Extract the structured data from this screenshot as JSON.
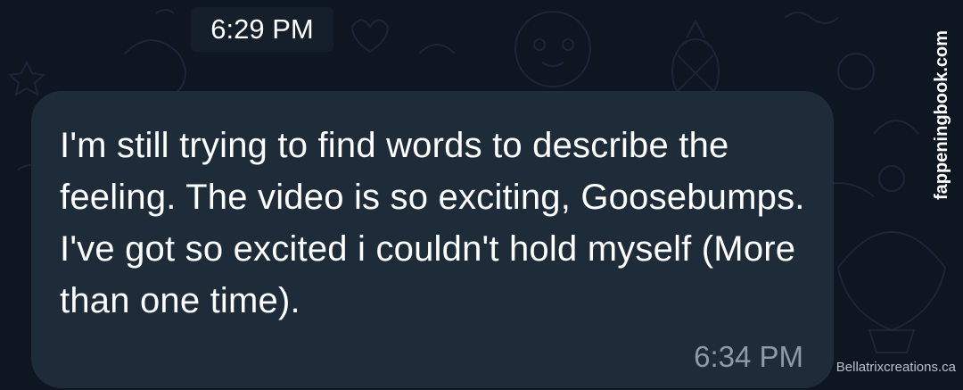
{
  "date_header": {
    "time": "6:29 PM"
  },
  "message": {
    "text": "I'm still trying to find words to describe the feeling. The video is so exciting, Goosebumps. I've got so excited i couldn't hold myself (More than one time).",
    "time": "6:34 PM",
    "bubble_color": "#1e2c3a"
  },
  "watermarks": {
    "side": "fappeningbook.com",
    "bottom": "Bellatrixcreations.ca"
  },
  "background": {
    "color": "#0e1621",
    "pattern_icons": [
      "sloth-icon",
      "pineapple-icon",
      "flamingo-icon",
      "heart-icon",
      "star-icon",
      "hot-air-balloon-icon"
    ]
  }
}
